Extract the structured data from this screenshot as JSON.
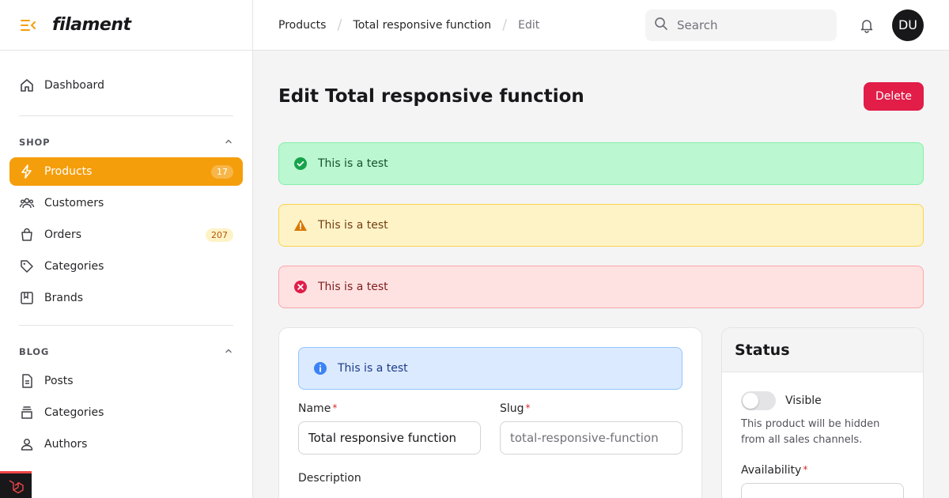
{
  "brand": {
    "name": "filament"
  },
  "sidebar": {
    "dashboard": {
      "label": "Dashboard"
    },
    "groups": [
      {
        "label": "SHOP",
        "items": [
          {
            "label": "Products",
            "badge": "17",
            "icon": "bolt-icon",
            "active": true
          },
          {
            "label": "Customers",
            "badge": "",
            "icon": "users-icon"
          },
          {
            "label": "Orders",
            "badge": "207",
            "icon": "shopping-bag-icon"
          },
          {
            "label": "Categories",
            "badge": "",
            "icon": "tag-icon"
          },
          {
            "label": "Brands",
            "badge": "",
            "icon": "bookmark-square-icon"
          }
        ]
      },
      {
        "label": "BLOG",
        "items": [
          {
            "label": "Posts",
            "icon": "document-icon"
          },
          {
            "label": "Categories",
            "icon": "inbox-stack-icon"
          },
          {
            "label": "Authors",
            "icon": "user-icon"
          }
        ]
      }
    ]
  },
  "topbar": {
    "breadcrumbs": [
      "Products",
      "Total responsive function",
      "Edit"
    ],
    "search_placeholder": "Search",
    "avatar_initials": "DU"
  },
  "page": {
    "title": "Edit Total responsive function",
    "delete_label": "Delete"
  },
  "alerts": {
    "success": "This is a test",
    "warning": "This is a test",
    "danger": "This is a test",
    "info": "This is a test"
  },
  "form": {
    "name_label": "Name",
    "name_value": "Total responsive function",
    "slug_label": "Slug",
    "slug_value": "total-responsive-function",
    "description_label": "Description"
  },
  "status_card": {
    "title": "Status",
    "visible_label": "Visible",
    "visible_help": "This product will be hidden from all sales channels.",
    "availability_label": "Availability"
  },
  "colors": {
    "primary": "#f59e0b",
    "danger": "#e11d48"
  }
}
